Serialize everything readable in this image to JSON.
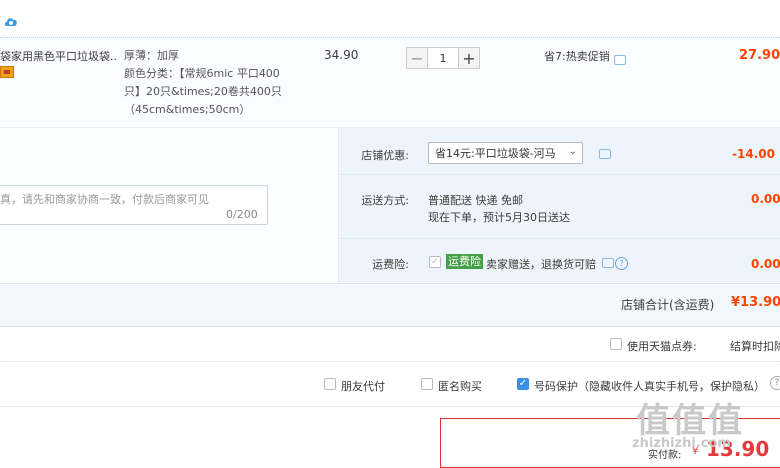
{
  "item": {
    "title": "袋家用黑色平口垃圾袋...",
    "specs": [
      "厚薄：加厚",
      "颜色分类：【常规6mic 平口400",
      "只】20只&times;20卷共400只",
      "（45cm&times;50cm）"
    ],
    "unit_price": "34.90",
    "quantity": "1",
    "minus": "−",
    "plus": "+",
    "promo": "省7:热卖促销",
    "subtotal": "27.90"
  },
  "message": {
    "placeholder": "真，请先和商家协商一致，付款后商家可见",
    "counter": "0/200"
  },
  "shop_discount": {
    "label": "店铺优惠:",
    "selected": "省14元:平口垃圾袋-河马",
    "value": "-14.00"
  },
  "shipping": {
    "label": "运送方式:",
    "line1": "普通配送 快递 免邮",
    "line2": "现在下单，预计5月30日送达",
    "value": "0.00"
  },
  "insurance": {
    "label": "运费险:",
    "badge": "运费险",
    "text": "卖家赠送，退换货可赔",
    "value": "0.00"
  },
  "shop_total": {
    "label": "店铺合计(含运费)",
    "value": "¥13.90"
  },
  "tmall": {
    "label": "使用天猫点券:",
    "note": "结算时扣除"
  },
  "options": {
    "friend_pay": "朋友代付",
    "anonymous": "匿名购买",
    "number_protect": "号码保护（隐藏收件人真实手机号，保护隐私）"
  },
  "payment": {
    "label": "实付款:",
    "currency": "¥",
    "value": "13.90"
  },
  "watermark": {
    "glyphs": "值值值",
    "domain": "zhizhizhi.com"
  },
  "colors": {
    "accent_red": "#ff4400",
    "link_blue": "#3a8ee6",
    "insurance_green": "#44a047"
  }
}
